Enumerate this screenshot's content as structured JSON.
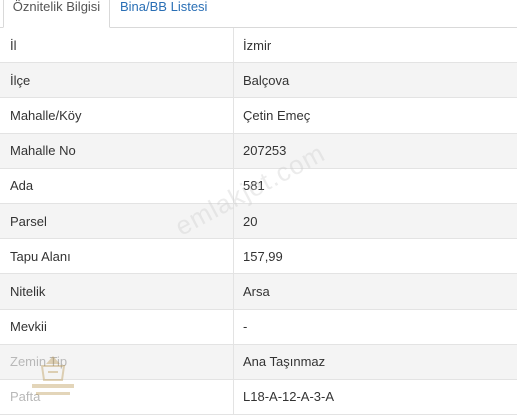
{
  "tabs": [
    {
      "label": "Öznitelik Bilgisi"
    },
    {
      "label": "Bina/BB Listesi"
    }
  ],
  "rows": [
    {
      "label": "İl",
      "value": "İzmir"
    },
    {
      "label": "İlçe",
      "value": "Balçova"
    },
    {
      "label": "Mahalle/Köy",
      "value": "Çetin Emeç"
    },
    {
      "label": "Mahalle No",
      "value": "207253"
    },
    {
      "label": "Ada",
      "value": "581"
    },
    {
      "label": "Parsel",
      "value": "20"
    },
    {
      "label": "Tapu Alanı",
      "value": "157,99"
    },
    {
      "label": "Nitelik",
      "value": "Arsa"
    },
    {
      "label": "Mevkii",
      "value": "-"
    },
    {
      "label": "Zemin Tip",
      "value": "Ana Taşınmaz"
    },
    {
      "label": "Pafta",
      "value": "L18-A-12-A-3-A"
    }
  ],
  "watermark": {
    "text": "emlakjet.com"
  }
}
